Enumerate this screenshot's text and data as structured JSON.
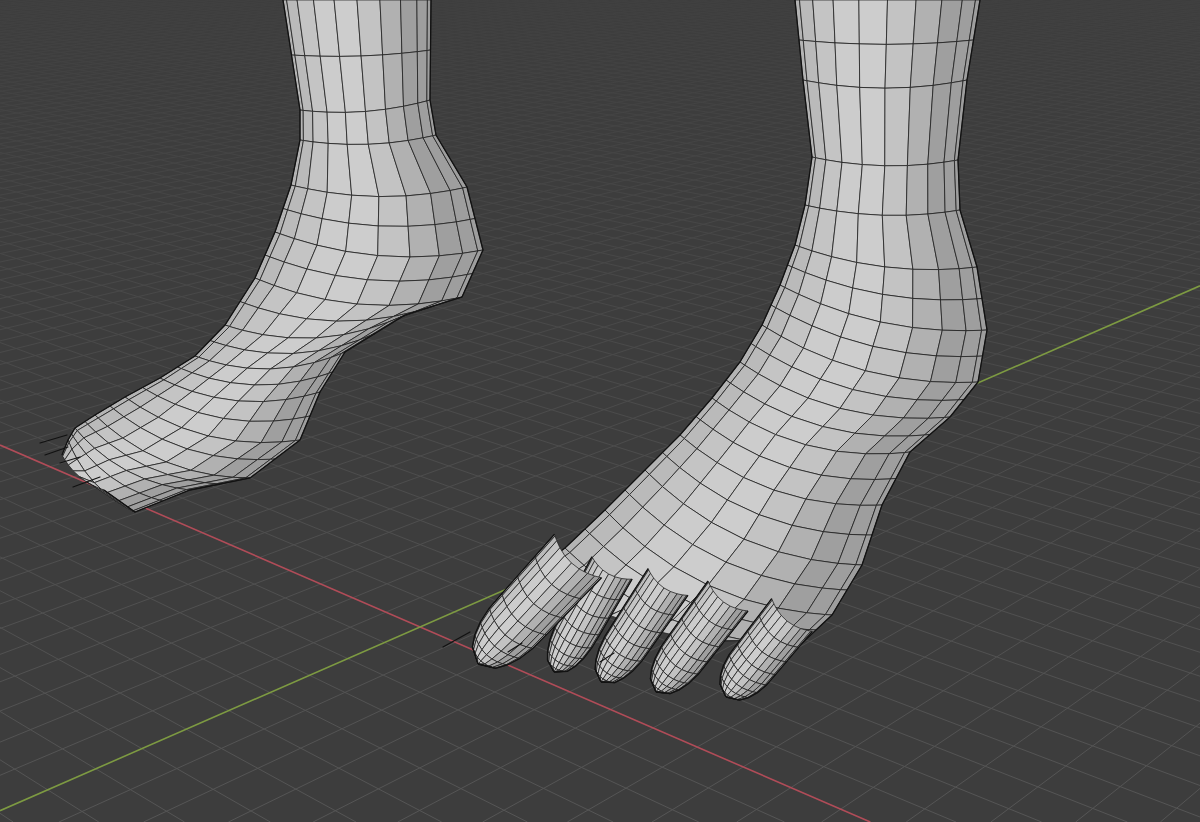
{
  "viewport": {
    "axes": [
      {
        "kind": "x",
        "color": "#b04c58"
      },
      {
        "kind": "y",
        "color": "#7d9a42"
      }
    ],
    "meshes": [
      {
        "kind": "foot"
      },
      {
        "kind": "foot"
      }
    ]
  }
}
